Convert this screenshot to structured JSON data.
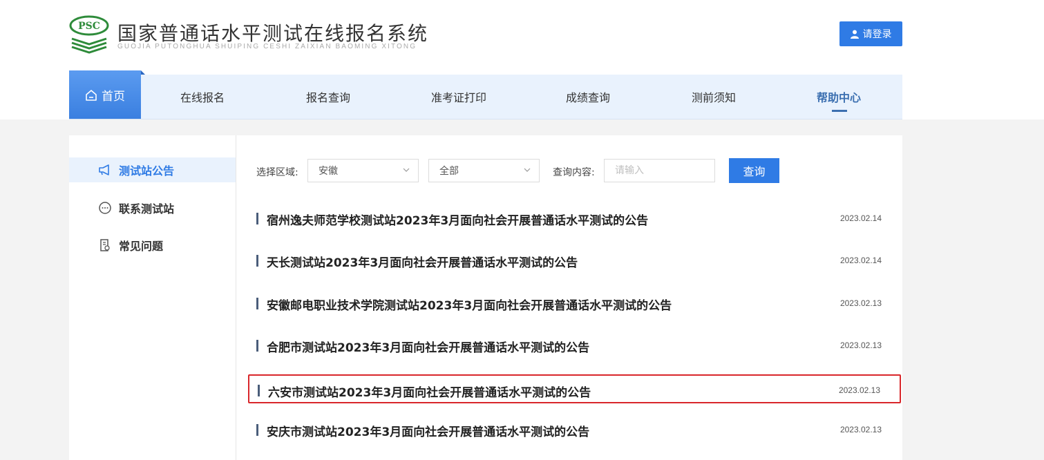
{
  "header": {
    "logo_text": "PSC",
    "title": "国家普通话水平测试在线报名系统",
    "subtitle": "GUOJIA PUTONGHUA SHUIPING CESHI ZAIXIAN BAOMING XITONG",
    "login_label": "请登录"
  },
  "nav": {
    "items": [
      {
        "label": "首页"
      },
      {
        "label": "在线报名"
      },
      {
        "label": "报名查询"
      },
      {
        "label": "准考证打印"
      },
      {
        "label": "成绩查询"
      },
      {
        "label": "测前须知"
      },
      {
        "label": "帮助中心"
      }
    ],
    "active": "帮助中心"
  },
  "sidebar": {
    "items": [
      {
        "label": "测试站公告",
        "icon": "megaphone-icon",
        "active": true
      },
      {
        "label": "联系测试站",
        "icon": "chat-bubble-icon"
      },
      {
        "label": "常见问题",
        "icon": "document-icon"
      }
    ]
  },
  "filters": {
    "region_label": "选择区域:",
    "region_value": "安徽",
    "scope_value": "全部",
    "query_label": "查询内容:",
    "query_placeholder": "请输入",
    "query_button": "查询"
  },
  "notices": [
    {
      "title": "宿州逸夫师范学校测试站2023年3月面向社会开展普通话水平测试的公告",
      "date": "2023.02.14"
    },
    {
      "title": "天长测试站2023年3月面向社会开展普通话水平测试的公告",
      "date": "2023.02.14"
    },
    {
      "title": "安徽邮电职业技术学院测试站2023年3月面向社会开展普通话水平测试的公告",
      "date": "2023.02.13"
    },
    {
      "title": "合肥市测试站2023年3月面向社会开展普通话水平测试的公告",
      "date": "2023.02.13"
    },
    {
      "title": "六安市测试站2023年3月面向社会开展普通话水平测试的公告",
      "date": "2023.02.13",
      "highlighted": true
    },
    {
      "title": "安庆市测试站2023年3月面向社会开展普通话水平测试的公告",
      "date": "2023.02.13"
    }
  ],
  "colors": {
    "accent": "#2f7be5",
    "nav_bg": "#e9f2fd",
    "highlight_border": "#d9262a",
    "logo_green": "#2e8b3a"
  }
}
